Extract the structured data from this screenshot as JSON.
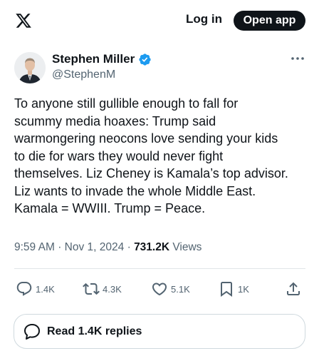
{
  "header": {
    "logo_icon": "x-logo-icon",
    "login_label": "Log in",
    "open_app_label": "Open app"
  },
  "author": {
    "name": "Stephen Miller",
    "handle": "@StephenM",
    "verified": true,
    "verified_color": "#1d9bf0"
  },
  "tweet": {
    "lines": [
      "To anyone still gullible enough to fall for",
      "scummy media hoaxes: Trump said",
      "warmongering neocons love sending your kids",
      "to die for wars they would never fight",
      "themselves. Liz Cheney is Kamala’s top advisor.",
      "Liz wants to invade the whole Middle East.",
      "Kamala = WWIII. Trump = Peace."
    ],
    "time": "9:59 AM",
    "separator": "·",
    "date": "Nov 1, 2024",
    "views_count": "731.2K",
    "views_label": "Views"
  },
  "actions": {
    "replies": "1.4K",
    "reposts": "4.3K",
    "likes": "5.1K",
    "bookmarks": "1K"
  },
  "replies_button": {
    "label": "Read 1.4K replies"
  },
  "colors": {
    "text": "#0f1419",
    "muted": "#536471",
    "accent": "#1d9bf0",
    "border": "#cfd9de"
  }
}
